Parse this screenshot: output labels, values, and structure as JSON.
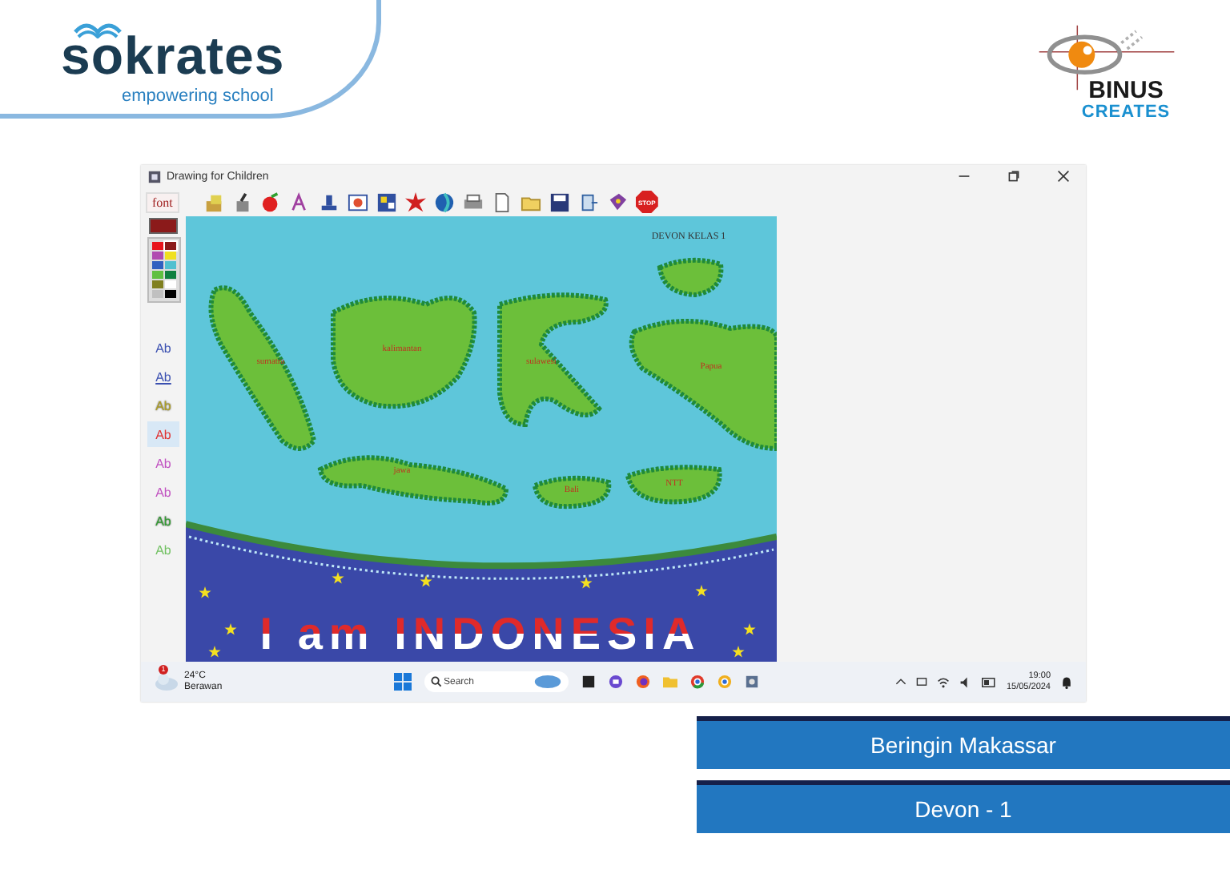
{
  "header": {
    "brand": "sokrates",
    "tagline": "empowering school",
    "partner": "BINUS",
    "partner_sub": "CREATES"
  },
  "window": {
    "title": "Drawing for Children"
  },
  "toolbar": {
    "font_button": "font",
    "stop_label": "STOP"
  },
  "palette": {
    "colors": [
      {
        "color": "#e8141c",
        "selected": false
      },
      {
        "color": "#8b1a1a",
        "selected": true
      },
      {
        "color": "#b04cb0",
        "selected": false
      },
      {
        "color": "#f0e020",
        "selected": false
      },
      {
        "color": "#3060c0",
        "selected": false
      },
      {
        "color": "#50c0d0",
        "selected": false
      },
      {
        "color": "#60c040",
        "selected": false
      },
      {
        "color": "#108040",
        "selected": false
      },
      {
        "color": "#808020",
        "selected": false
      },
      {
        "color": "#ffffff",
        "selected": false
      },
      {
        "color": "#c0c0c0",
        "selected": false
      },
      {
        "color": "#000000",
        "selected": false
      }
    ]
  },
  "text_styles": [
    {
      "label": "Ab",
      "color": "#3a4fb0",
      "kind": "plain",
      "selected": false
    },
    {
      "label": "Ab",
      "color": "#3a4fb0",
      "kind": "underline",
      "selected": false
    },
    {
      "label": "Ab",
      "color": "#b0a020",
      "kind": "outline",
      "selected": false
    },
    {
      "label": "Ab",
      "color": "#e03030",
      "kind": "plain",
      "selected": true
    },
    {
      "label": "Ab",
      "color": "#c050c0",
      "kind": "plain",
      "selected": false
    },
    {
      "label": "Ab",
      "color": "#c050c0",
      "kind": "plain",
      "selected": false
    },
    {
      "label": "Ab",
      "color": "#30a030",
      "kind": "outline",
      "selected": false
    },
    {
      "label": "Ab",
      "color": "#70c060",
      "kind": "plain",
      "selected": false
    }
  ],
  "canvas": {
    "caption": "DEVON KELAS 1",
    "islands": [
      {
        "label": "sumatra"
      },
      {
        "label": "kalimantan"
      },
      {
        "label": "sulawesi"
      },
      {
        "label": "Papua"
      },
      {
        "label": "jawa"
      },
      {
        "label": "Bali"
      },
      {
        "label": "NTT"
      }
    ],
    "slogan": "I am INDONESIA"
  },
  "taskbar": {
    "weather": {
      "temperature": "24°C",
      "condition": "Berawan",
      "badge": "1"
    },
    "search": {
      "placeholder": "Search"
    },
    "time": "19:00",
    "date": "15/05/2024"
  },
  "banners": [
    {
      "text": "Beringin Makassar"
    },
    {
      "text": "Devon - 1"
    }
  ]
}
